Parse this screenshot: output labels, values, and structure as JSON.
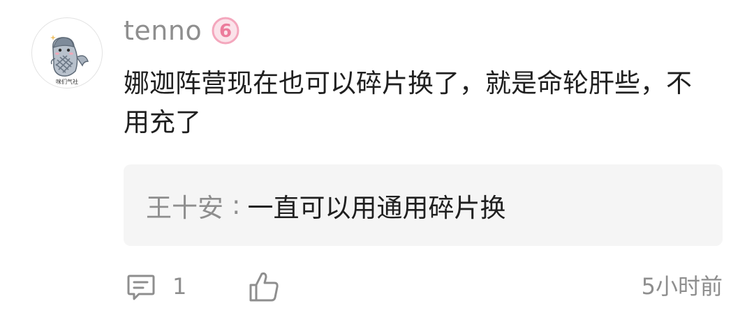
{
  "comment": {
    "avatar_icon": "whale-mascot-avatar",
    "avatar_caption": "咪们气社",
    "username": "tenno",
    "level_badge_icon": "level-6-badge",
    "level_badge_value": "6",
    "level_badge_color": "#f4a7bd",
    "text": "娜迦阵营现在也可以碎片换了，就是命轮肝些，不用充了"
  },
  "reply_preview": {
    "author": "王十安",
    "separator": ":",
    "text": "一直可以用通用碎片换"
  },
  "footer": {
    "reply_icon": "comment-bubble-icon",
    "reply_count": "1",
    "like_icon": "thumbs-up-icon",
    "timestamp": "5小时前"
  },
  "colors": {
    "muted": "#8e8e8e",
    "text": "#1f1f1f",
    "reply_bg": "#f5f5f5"
  }
}
